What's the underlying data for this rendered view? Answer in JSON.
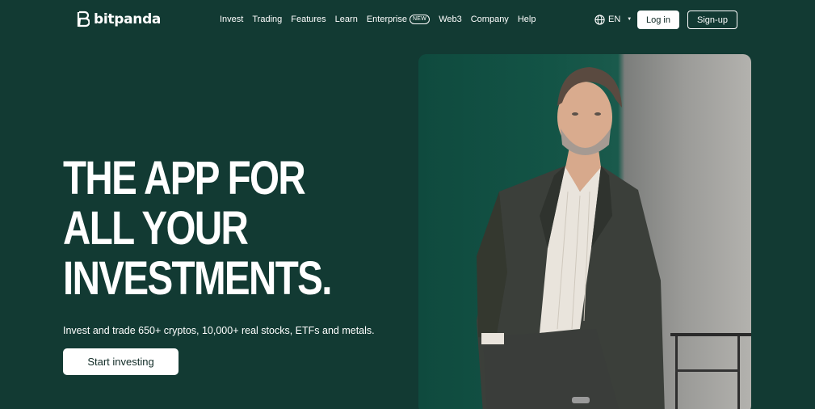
{
  "brand": {
    "name": "bitpanda"
  },
  "nav": {
    "items": [
      "Invest",
      "Trading",
      "Features",
      "Learn",
      "Enterprise",
      "Web3",
      "Company",
      "Help"
    ],
    "enterprise_badge": "NEW"
  },
  "header": {
    "language": "EN",
    "login_label": "Log in",
    "signup_label": "Sign-up"
  },
  "hero": {
    "headline_lines": [
      "THE APP FOR",
      "ALL YOUR",
      "INVESTMENTS."
    ],
    "subtitle": "Invest and trade 650+ cryptos, 10,000+ real stocks, ETFs and metals.",
    "cta_label": "Start investing"
  },
  "colors": {
    "background": "#123a33",
    "text": "#ffffff",
    "button_text": "#0f2a25"
  }
}
